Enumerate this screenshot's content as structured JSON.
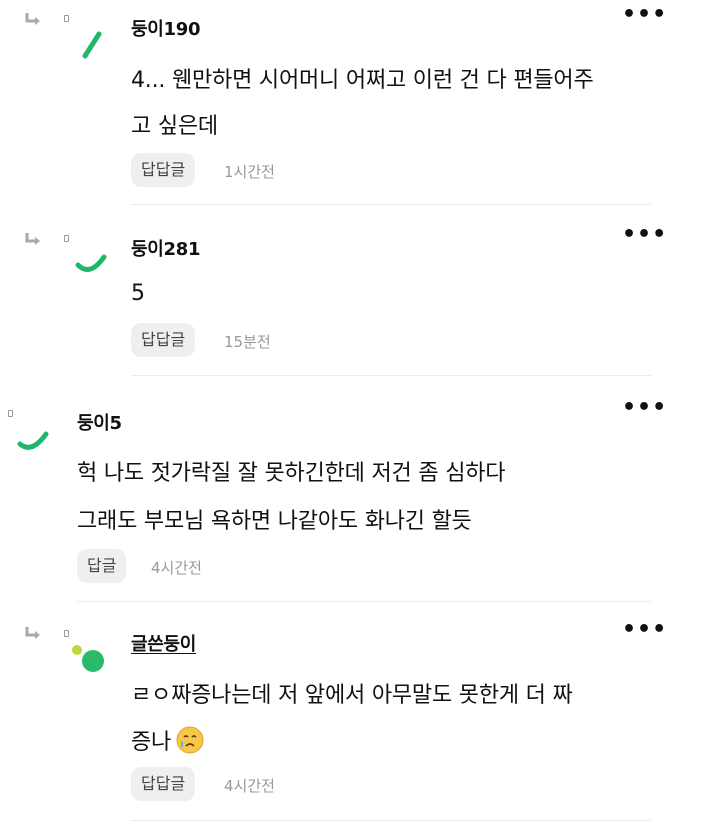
{
  "comments": [
    {
      "nickname": "둥이190",
      "lines": [
        "4... 웬만하면 시어머니 어쩌고 이런 건 다 편들어주",
        "고 싶은데"
      ],
      "reply_label": "답답글",
      "time": "1시간전",
      "more": "•••"
    },
    {
      "nickname": "둥이281",
      "lines": [
        "5"
      ],
      "reply_label": "답답글",
      "time": "15분전",
      "more": "•••"
    },
    {
      "nickname": "둥이5",
      "lines": [
        "헉 나도 젓가락질 잘 못하긴한데 저건 좀 심하다",
        "그래도 부모님 욕하면 나같아도 화나긴 할듯"
      ],
      "reply_label": "답글",
      "time": "4시간전",
      "more": "•••"
    },
    {
      "nickname": "글쓴둥이",
      "lines": [
        "ㄹㅇ짜증나는데 저 앞에서 아무말도 못한게 더 짜",
        "증나"
      ],
      "reply_label": "답답글",
      "time": "4시간전",
      "more": "•••"
    }
  ],
  "colors": {
    "accent": "#1fb86a",
    "muted": "#999999",
    "button_bg": "#efefef"
  }
}
